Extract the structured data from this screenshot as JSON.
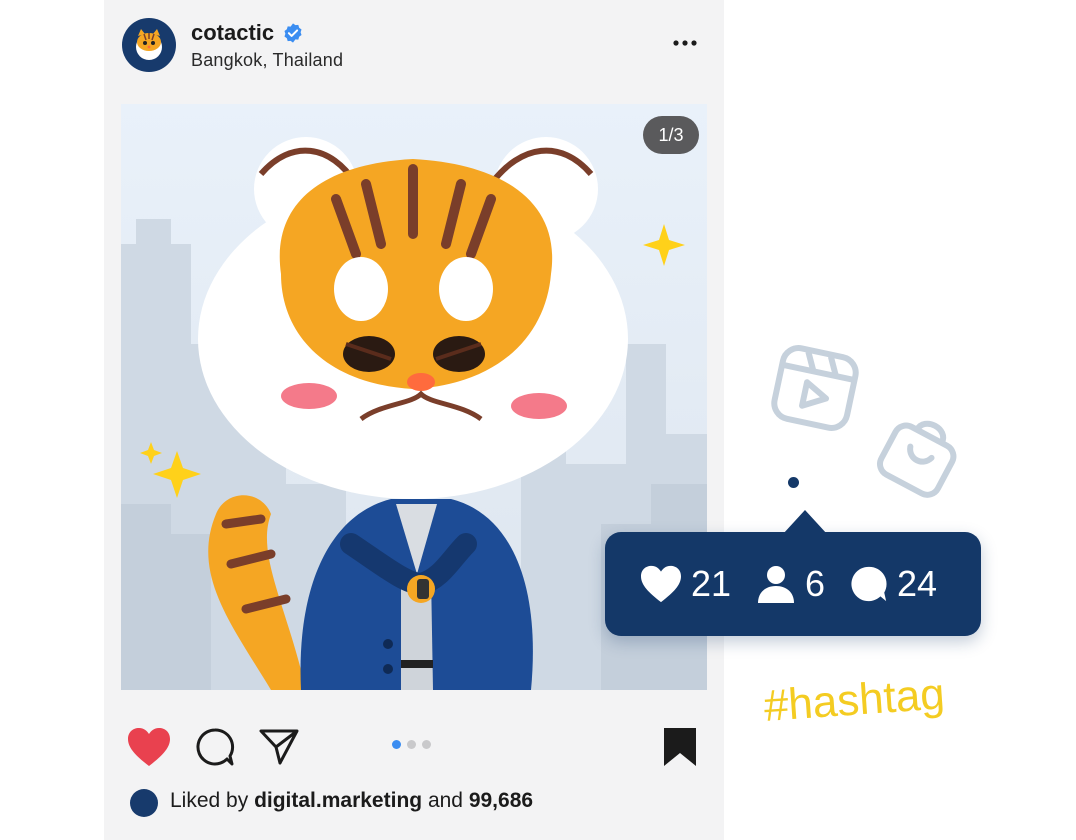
{
  "post": {
    "username": "cotactic",
    "location": "Bangkok, Thailand",
    "image_counter": "1/3",
    "carousel": {
      "count": 3,
      "active_index": 0
    },
    "liked_by_prefix": "Liked by",
    "liked_by_user": "digital.marketing",
    "liked_by_and": "and",
    "liked_by_count": "99,686",
    "liked": true,
    "saved": true
  },
  "notification": {
    "likes": "21",
    "follows": "6",
    "comments": "24"
  },
  "decor": {
    "hashtag": "#hashtag"
  },
  "colors": {
    "accent_blue": "#143868",
    "like_red": "#e9414f",
    "hashtag_yellow": "#f4cc22",
    "verified_blue": "#3b8df1"
  },
  "icons": {
    "verified": "verified-badge-icon",
    "more": "more-options-icon",
    "like": "heart-icon",
    "comment": "comment-icon",
    "share": "send-icon",
    "save": "bookmark-icon",
    "reels": "reels-icon",
    "shop": "shopping-bag-icon"
  }
}
